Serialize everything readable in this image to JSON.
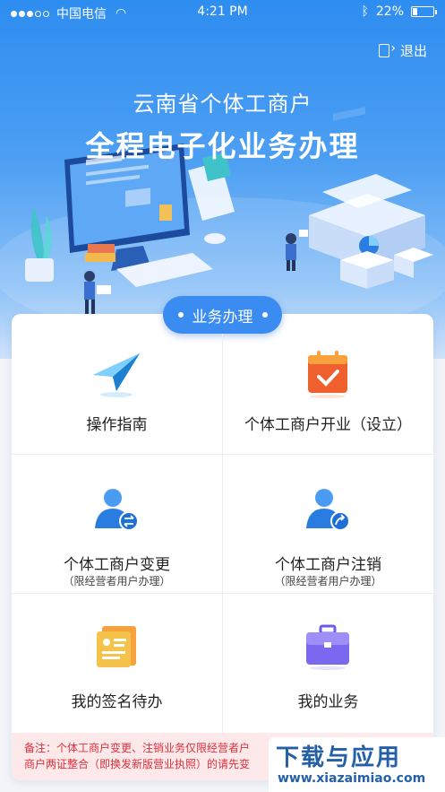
{
  "status_bar": {
    "carrier": "中国电信",
    "time": "4:21 PM",
    "battery": "22%",
    "battery_level": 0.22
  },
  "header": {
    "logout_label": "退出",
    "title_line1": "云南省个体工商户",
    "title_line2": "全程电子化业务办理"
  },
  "section": {
    "title": "业务办理"
  },
  "services": [
    {
      "label": "操作指南",
      "sub": "",
      "icon": "paper-plane-icon"
    },
    {
      "label": "个体工商户开业（设立）",
      "sub": "",
      "icon": "calendar-check-icon"
    },
    {
      "label": "个体工商户变更",
      "sub": "（限经营者用户办理）",
      "icon": "user-exchange-icon"
    },
    {
      "label": "个体工商户注销",
      "sub": "（限经营者用户办理）",
      "icon": "user-cancel-icon"
    },
    {
      "label": "我的签名待办",
      "sub": "",
      "icon": "signature-doc-icon"
    },
    {
      "label": "我的业务",
      "sub": "",
      "icon": "briefcase-icon"
    }
  ],
  "note": {
    "line1": "备注：个体工商户变更、注销业务仅限经营者户",
    "line2": "商户两证整合（即换发新版营业执照）的请先变"
  },
  "watermark": {
    "title": "下载与应用",
    "url": "www.xiazaimiao.com"
  },
  "colors": {
    "primary": "#3a8cf0",
    "note_text": "#e0303c",
    "note_bg": "#fde8ea"
  }
}
